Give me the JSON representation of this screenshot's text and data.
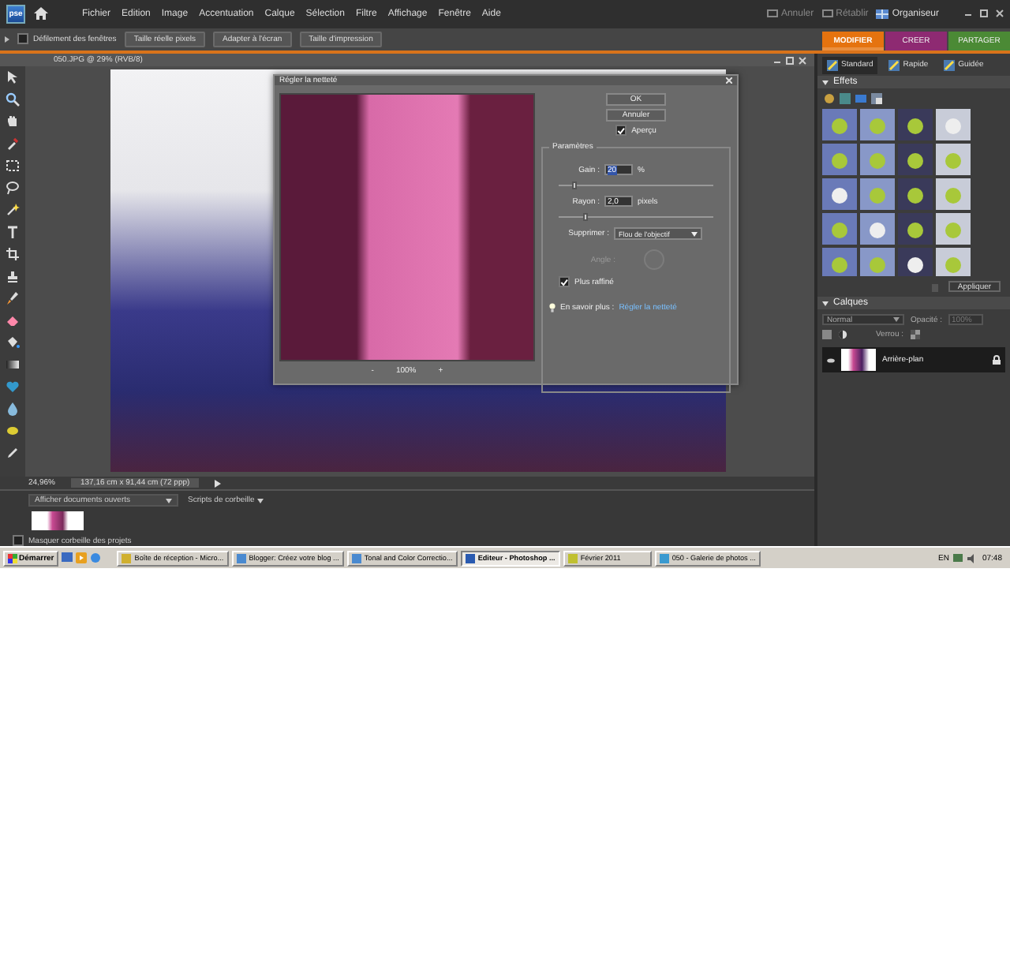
{
  "app": {
    "logo": "pse",
    "menu": [
      "Fichier",
      "Edition",
      "Image",
      "Accentuation",
      "Calque",
      "Sélection",
      "Filtre",
      "Affichage",
      "Fenêtre",
      "Aide"
    ],
    "history": [
      {
        "label": "Annuler",
        "disabled": true
      },
      {
        "label": "Rétablir",
        "disabled": true
      }
    ],
    "organizer": "Organiseur"
  },
  "options_bar": {
    "scroll_windows": {
      "label": "Défilement des fenêtres",
      "checked": false
    },
    "buttons": [
      "Taille réelle pixels",
      "Adapter à l'écran",
      "Taille d'impression"
    ]
  },
  "mode_tabs": [
    {
      "label": "MODIFIER",
      "selected": true,
      "color": "#e5730f"
    },
    {
      "label": "CREER",
      "selected": false,
      "color": "#8e2a72"
    },
    {
      "label": "PARTAGER",
      "selected": false,
      "color": "#4b8a35"
    }
  ],
  "edit_modes": [
    {
      "label": "Standard",
      "selected": true
    },
    {
      "label": "Rapide",
      "selected": false
    },
    {
      "label": "Guidée",
      "selected": false
    }
  ],
  "document": {
    "title": "050.JPG @ 29% (RVB/8)",
    "zoom": "24,96%",
    "size": "137,16 cm x 91,44 cm (72 ppp)"
  },
  "dialog": {
    "title": "Régler la netteté",
    "ok": "OK",
    "cancel": "Annuler",
    "preview": {
      "label": "Aperçu",
      "checked": true
    },
    "zoom_out": "-",
    "preview_zoom": "100%",
    "zoom_in": "+",
    "group": "Paramètres",
    "gain": {
      "label": "Gain :",
      "value": "20",
      "unit": "%",
      "level": 0.1
    },
    "radius": {
      "label": "Rayon :",
      "value": "2,0",
      "unit": "pixels",
      "level": 0.17
    },
    "remove": {
      "label": "Supprimer :",
      "value": "Flou de l'objectif"
    },
    "angle": {
      "label": "Angle :",
      "disabled": true
    },
    "finer": {
      "label": "Plus raffiné",
      "checked": true
    },
    "learn_more": {
      "label": "En savoir plus :",
      "link": "Régler la netteté"
    }
  },
  "project_bin": {
    "show": "Afficher documents ouverts",
    "scripts": "Scripts de corbeille",
    "hide": {
      "label": "Masquer corbeille des projets",
      "checked": false
    }
  },
  "effects": {
    "title": "Effets",
    "apply": "Appliquer"
  },
  "layers": {
    "title": "Calques",
    "blend_mode": "Normal",
    "opacity_label": "Opacité :",
    "opacity": "100%",
    "lock_label": "Verrou :",
    "items": [
      {
        "name": "Arrière-plan",
        "selected": true,
        "locked": true
      }
    ]
  },
  "taskbar": {
    "start": "Démarrer",
    "tasks": [
      {
        "label": "Boîte de réception - Micro...",
        "selected": false
      },
      {
        "label": "Blogger: Créez votre blog ...",
        "selected": false
      },
      {
        "label": "Tonal and Color Correctio...",
        "selected": false
      },
      {
        "label": "Editeur - Photoshop ...",
        "selected": true
      },
      {
        "label": "Février 2011",
        "selected": false
      },
      {
        "label": "050 - Galerie de photos ...",
        "selected": false
      }
    ],
    "language": "EN",
    "clock": "07:48"
  }
}
